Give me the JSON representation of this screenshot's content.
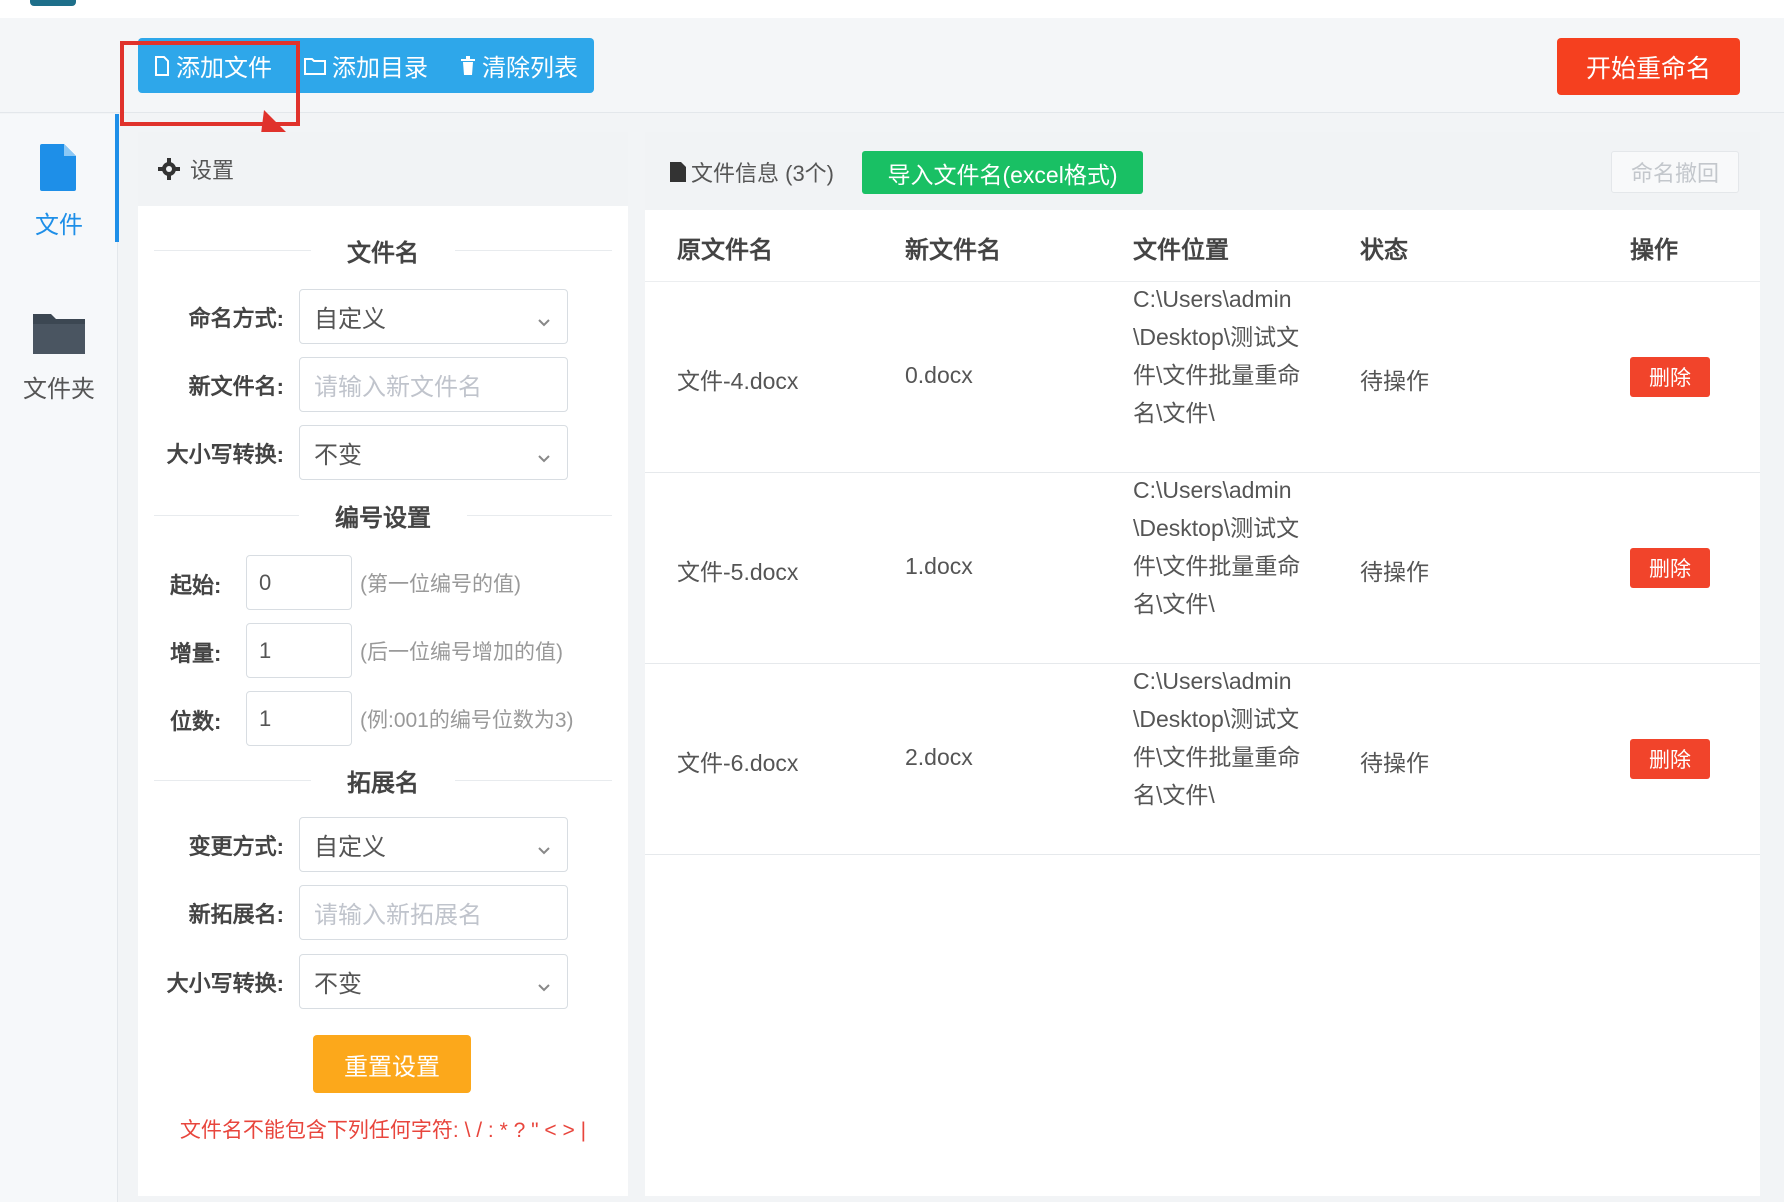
{
  "toolbar": {
    "add_file": "添加文件",
    "add_dir": "添加目录",
    "clear_list": "清除列表",
    "start_rename": "开始重命名"
  },
  "nav": {
    "file": "文件",
    "folder": "文件夹"
  },
  "settings": {
    "header": "设置",
    "filename_section": "文件名",
    "naming_mode_label": "命名方式:",
    "naming_mode_value": "自定义",
    "new_name_label": "新文件名:",
    "new_name_placeholder": "请输入新文件名",
    "case_label": "大小写转换:",
    "case_value": "不变",
    "numbering_section": "编号设置",
    "start_label": "起始:",
    "start_value": "0",
    "start_hint": "(第一位编号的值)",
    "increment_label": "增量:",
    "increment_value": "1",
    "increment_hint": "(后一位编号增加的值)",
    "digits_label": "位数:",
    "digits_value": "1",
    "digits_hint": "(例:001的编号位数为3)",
    "ext_section": "拓展名",
    "ext_mode_label": "变更方式:",
    "ext_mode_value": "自定义",
    "new_ext_label": "新拓展名:",
    "new_ext_placeholder": "请输入新拓展名",
    "ext_case_label": "大小写转换:",
    "ext_case_value": "不变",
    "reset_button": "重置设置",
    "warning": "文件名不能包含下列任何字符: \\ / : * ? \" < > |"
  },
  "files": {
    "title": "文件信息 (3个)",
    "import_button": "导入文件名(excel格式)",
    "undo_button": "命名撤回",
    "columns": [
      "原文件名",
      "新文件名",
      "文件位置",
      "状态",
      "操作"
    ],
    "rows": [
      {
        "original": "文件-4.docx",
        "new": "0.docx",
        "location": "C:\\Users\\admin\\Desktop\\测试文件\\文件批量重命名\\文件\\",
        "status": "待操作",
        "action": "删除"
      },
      {
        "original": "文件-5.docx",
        "new": "1.docx",
        "location": "C:\\Users\\admin\\Desktop\\测试文件\\文件批量重命名\\文件\\",
        "status": "待操作",
        "action": "删除"
      },
      {
        "original": "文件-6.docx",
        "new": "2.docx",
        "location": "C:\\Users\\admin\\Desktop\\测试文件\\文件批量重命名\\文件\\",
        "status": "待操作",
        "action": "删除"
      }
    ]
  },
  "colors": {
    "toolbar_blue": "#2ea7ea",
    "start_red": "#f5401f",
    "import_green": "#19c064",
    "reset_orange": "#fca81b",
    "delete_red": "#f1442b",
    "nav_active": "#1e8fe8",
    "annotation_red": "#e0322c"
  },
  "icons": {
    "add_file": "file-outline-icon",
    "add_dir": "folder-outline-icon",
    "clear_list": "trash-icon",
    "nav_file": "file-icon",
    "nav_folder": "folder-icon",
    "settings": "gear-icon",
    "file_info": "document-icon",
    "select": "chevron-down-icon"
  }
}
